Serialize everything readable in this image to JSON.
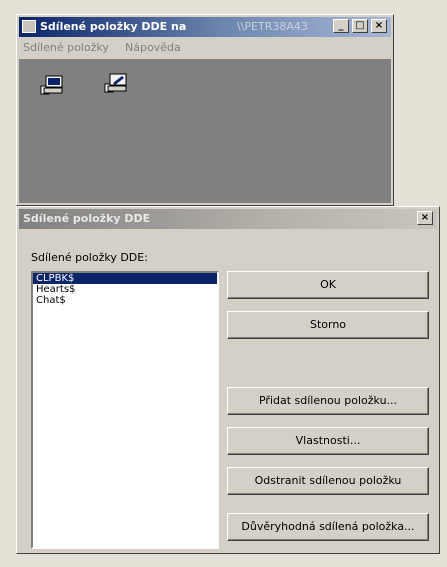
{
  "main_window": {
    "title": "Sdílené položky DDE na",
    "title_suffix": "\\\\PETR38A43",
    "buttons": {
      "minimize": "_",
      "maximize": "□",
      "close": "×"
    },
    "menu": [
      {
        "label": "Sdílené položky"
      },
      {
        "label": "Nápověda"
      }
    ],
    "icons": [
      "shared-item-icon",
      "edit-share-icon"
    ]
  },
  "dialog": {
    "title": "Sdílené položky DDE",
    "close": "×",
    "list_label": "Sdílené položky DDE:",
    "items": [
      {
        "label": "CLPBK$",
        "selected": true
      },
      {
        "label": "Hearts$",
        "selected": false
      },
      {
        "label": "Chat$",
        "selected": false
      }
    ],
    "buttons": {
      "ok": "OK",
      "cancel": "Storno",
      "add": "Přidat sdílenou položku...",
      "properties": "Vlastnosti...",
      "remove": "Odstranit sdílenou položku",
      "trusted": "Důvěryhodná sdílená položka..."
    }
  },
  "colors": {
    "active_title": "#0a246a",
    "inactive_title": "#808080",
    "face": "#d4d0c8",
    "selection": "#0a246a"
  }
}
